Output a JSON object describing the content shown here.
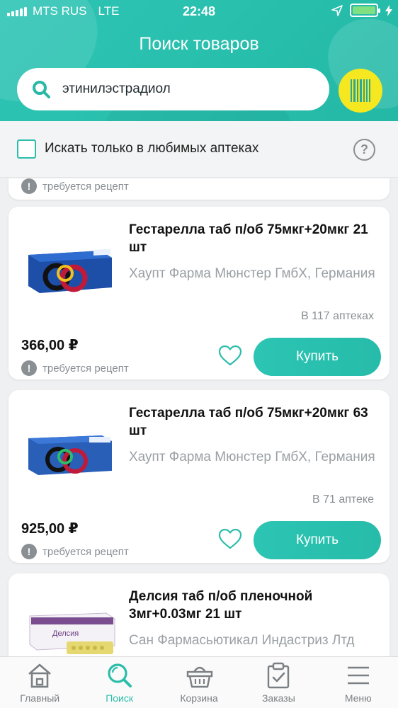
{
  "status_bar": {
    "carrier": "MTS RUS",
    "network": "LTE",
    "time": "22:48"
  },
  "header": {
    "title": "Поиск товаров"
  },
  "search": {
    "query": "этинилэстрадиол"
  },
  "filter": {
    "label": "Искать только в любимых аптеках",
    "checked": false,
    "help_label": "?"
  },
  "partial_card": {
    "prescription": "требуется рецепт"
  },
  "products": [
    {
      "name": "Гестарелла таб п/об 75мкг+20мкг 21 шт",
      "manufacturer": "Хаупт Фарма Мюнстер ГмбХ, Германия",
      "availability": "В 117 аптеках",
      "price": "366,00 ₽",
      "prescription": "требуется рецепт",
      "buy_label": "Купить"
    },
    {
      "name": "Гестарелла таб п/об 75мкг+20мкг 63 шт",
      "manufacturer": "Хаупт Фарма Мюнстер ГмбХ, Германия",
      "availability": "В 71 аптеке",
      "price": "925,00 ₽",
      "prescription": "требуется рецепт",
      "buy_label": "Купить"
    },
    {
      "name": "Делсия таб п/об пленочной 3мг+0.03мг 21 шт",
      "manufacturer": "Сан Фармасьютикал Индастриз Лтд",
      "image_text": "Делсия"
    }
  ],
  "tabs": [
    {
      "label": "Главный",
      "icon": "home-icon",
      "active": false
    },
    {
      "label": "Поиск",
      "icon": "search-icon",
      "active": true
    },
    {
      "label": "Корзина",
      "icon": "basket-icon",
      "active": false
    },
    {
      "label": "Заказы",
      "icon": "orders-clipboard-icon",
      "active": false
    },
    {
      "label": "Меню",
      "icon": "menu-icon",
      "active": false
    }
  ],
  "colors": {
    "accent": "#2bbdaa",
    "barcode_button": "#f5e821",
    "battery": "#7fe081"
  }
}
